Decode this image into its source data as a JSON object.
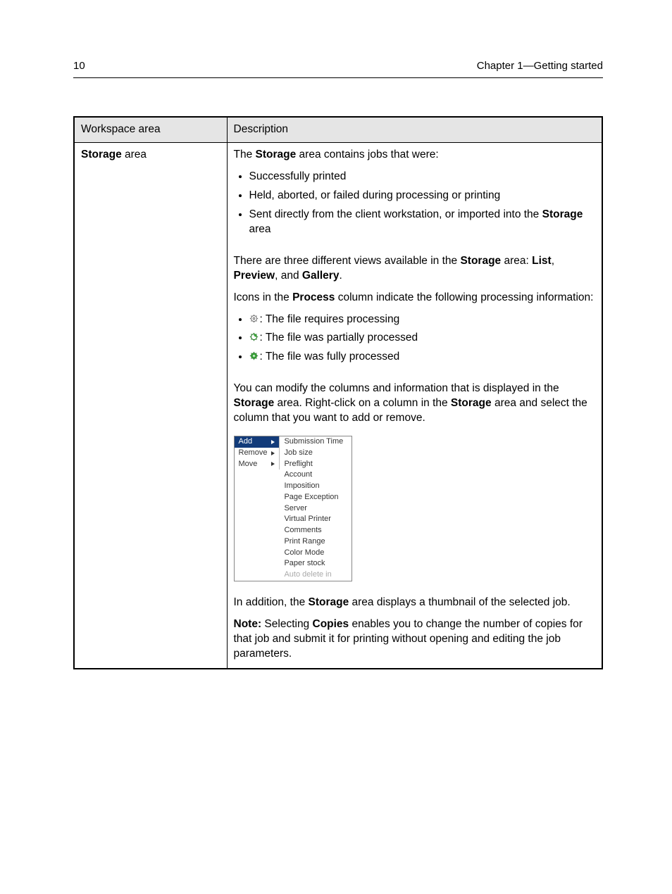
{
  "header": {
    "page_number": "10",
    "chapter": "Chapter 1—Getting started"
  },
  "table": {
    "headers": {
      "col1": "Workspace area",
      "col2": "Description"
    },
    "row": {
      "label_bold": "Storage",
      "label_rest": " area",
      "intro_pre": "The ",
      "intro_bold": "Storage",
      "intro_post": " area contains jobs that were:",
      "bullets1": {
        "b1": "Successfully printed",
        "b2": "Held, aborted, or failed during processing or printing",
        "b3_pre": "Sent directly from the client workstation, or imported into the ",
        "b3_bold": "Storage",
        "b3_post": " area"
      },
      "views": {
        "pre": "There are three different views available in the ",
        "s1": "Storage",
        "mid1": " area: ",
        "s2": "List",
        "mid2": ", ",
        "s3": "Preview",
        "mid3": ", and ",
        "s4": "Gallery",
        "post": "."
      },
      "icons_intro": {
        "pre": "Icons in the ",
        "bold": "Process",
        "post": " column indicate the following processing information:"
      },
      "icon_list": {
        "i1": ": The file requires processing",
        "i2": ": The file was partially processed",
        "i3": ": The file was fully processed"
      },
      "modify": {
        "pre": "You can modify the columns and information that is displayed in the ",
        "s1": "Storage",
        "mid": " area. Right-click on a column in the ",
        "s2": "Storage",
        "post": " area and select the column that you want to add or remove."
      },
      "menu": {
        "left": {
          "add": "Add",
          "remove": "Remove",
          "move": "Move"
        },
        "right": {
          "r1": "Submission Time",
          "r2": "Job size",
          "r3": "Preflight",
          "r4": "Account",
          "r5": "Imposition",
          "r6": "Page Exception",
          "r7": "Server",
          "r8": "Virtual Printer",
          "r9": "Comments",
          "r10": "Print Range",
          "r11": "Color Mode",
          "r12": "Paper stock",
          "r13": "Auto delete in"
        }
      },
      "thumb": {
        "pre": "In addition, the ",
        "bold": "Storage",
        "post": " area displays a thumbnail of the selected job."
      },
      "note": {
        "n1": "Note:",
        "pre": " Selecting ",
        "bold": "Copies",
        "post": " enables you to change the number of copies for that job and submit it for printing without opening and editing the job parameters."
      }
    }
  }
}
